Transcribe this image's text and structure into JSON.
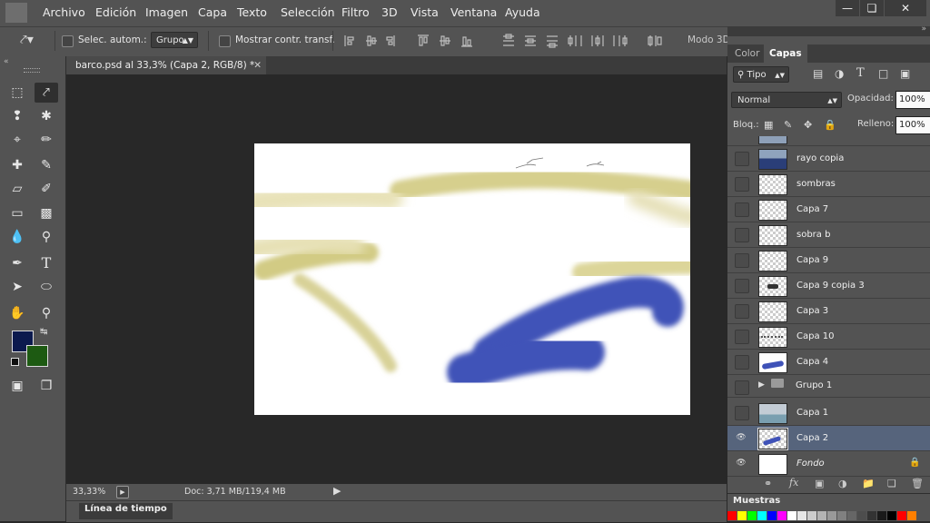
{
  "menu": [
    "Archivo",
    "Edición",
    "Imagen",
    "Capa",
    "Texto",
    "Selección",
    "Filtro",
    "3D",
    "Vista",
    "Ventana",
    "Ayuda"
  ],
  "options": {
    "auto_select_label": "Selec. autom.:",
    "auto_select_value": "Grupo",
    "show_transform_label": "Mostrar contr. transf.",
    "mode3d_label": "Modo 3D:"
  },
  "document": {
    "tab_title": "barco.psd al 33,3% (Capa 2, RGB/8) *",
    "zoom": "33,33%",
    "doc_info": "Doc: 3,71 MB/119,4 MB"
  },
  "timeline_label": "Línea de tiempo",
  "panels": {
    "tab_color": "Color",
    "tab_layers": "Capas",
    "filter_kind": "Tipo",
    "blend_mode": "Normal",
    "opacity_label": "Opacidad:",
    "opacity_value": "100%",
    "lock_label": "Bloq.:",
    "fill_label": "Relleno:",
    "fill_value": "100%",
    "swatches_title": "Muestras"
  },
  "layers": [
    {
      "name": "rayo copia",
      "visible": false,
      "thumb": "boat"
    },
    {
      "name": "sombras",
      "visible": false,
      "thumb": "empty"
    },
    {
      "name": "Capa 7",
      "visible": false,
      "thumb": "empty"
    },
    {
      "name": "sobra b",
      "visible": false,
      "thumb": "empty"
    },
    {
      "name": "Capa 9",
      "visible": false,
      "thumb": "empty"
    },
    {
      "name": "Capa 9 copia 3",
      "visible": false,
      "thumb": "boat-small"
    },
    {
      "name": "Capa 3",
      "visible": false,
      "thumb": "empty"
    },
    {
      "name": "Capa 10",
      "visible": false,
      "thumb": "dots"
    },
    {
      "name": "Capa 4",
      "visible": false,
      "thumb": "blue-stroke"
    },
    {
      "name": "Grupo 1",
      "visible": false,
      "thumb": "folder"
    },
    {
      "name": "Capa 1",
      "visible": false,
      "thumb": "sea"
    },
    {
      "name": "Capa 2",
      "visible": true,
      "thumb": "strokes",
      "selected": true
    },
    {
      "name": "Fondo",
      "visible": true,
      "thumb": "white",
      "locked": true
    }
  ],
  "colors": {
    "foreground": "#0c1a4e",
    "background": "#1d5a12",
    "canvas_blue": "#3f52b8",
    "canvas_olive": "#d2cb84",
    "selected_row": "#56647c",
    "swatches": [
      "#ff0000",
      "#ffff00",
      "#00ff00",
      "#00ffff",
      "#0000ff",
      "#ff00ff",
      "#ffffff",
      "#e6e6e6",
      "#cccccc",
      "#b3b3b3",
      "#999999",
      "#808080",
      "#666666",
      "#4d4d4d",
      "#333333",
      "#1a1a1a",
      "#000000",
      "#ff0000",
      "#ff7f00"
    ]
  }
}
